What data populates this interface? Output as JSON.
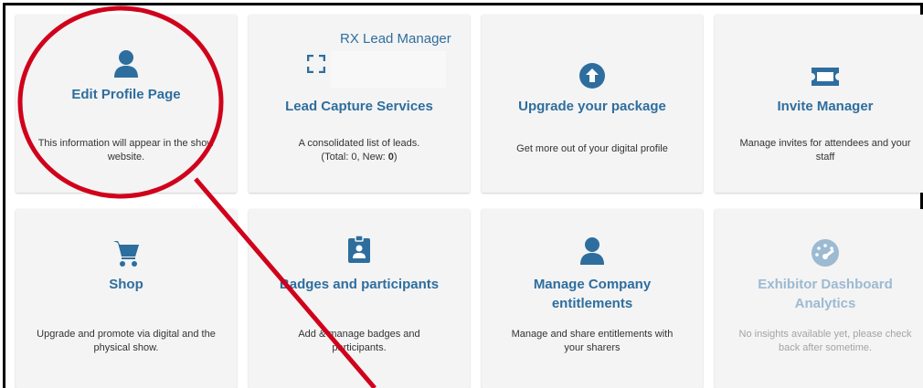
{
  "overlay_label": "RX Lead Manager",
  "tiles": [
    {
      "icon": "user-icon",
      "title": "Edit Profile Page",
      "desc": "This information will appear in the show website."
    },
    {
      "icon": "qr-scan-icon",
      "title": "Lead Capture Services",
      "desc_line1": "A consolidated list of leads.",
      "desc_line2_prefix": "(Total: 0, New: ",
      "desc_line2_bold": "0",
      "desc_line2_suffix": ")"
    },
    {
      "icon": "arrow-up-circle-icon",
      "title": "Upgrade your package",
      "desc": "Get more out of your digital profile"
    },
    {
      "icon": "ticket-icon",
      "title": "Invite Manager",
      "desc": "Manage invites for attendees and your staff"
    },
    {
      "icon": "cart-icon",
      "title": "Shop",
      "desc": "Upgrade and promote via digital and the physical show."
    },
    {
      "icon": "badge-icon",
      "title": "Badges and participants",
      "desc": "Add & manage badges and participants."
    },
    {
      "icon": "user-icon",
      "title": "Manage Company entitlements",
      "desc": "Manage and share entitlements with your sharers"
    },
    {
      "icon": "gauge-icon",
      "title": "Exhibitor Dashboard Analytics",
      "desc": "No insights available yet, please check back after sometime."
    }
  ],
  "colors": {
    "accent": "#2e6e9e",
    "disabled": "#9cbad2",
    "annotation": "#d0021b",
    "tile_bg": "#f4f4f4"
  }
}
